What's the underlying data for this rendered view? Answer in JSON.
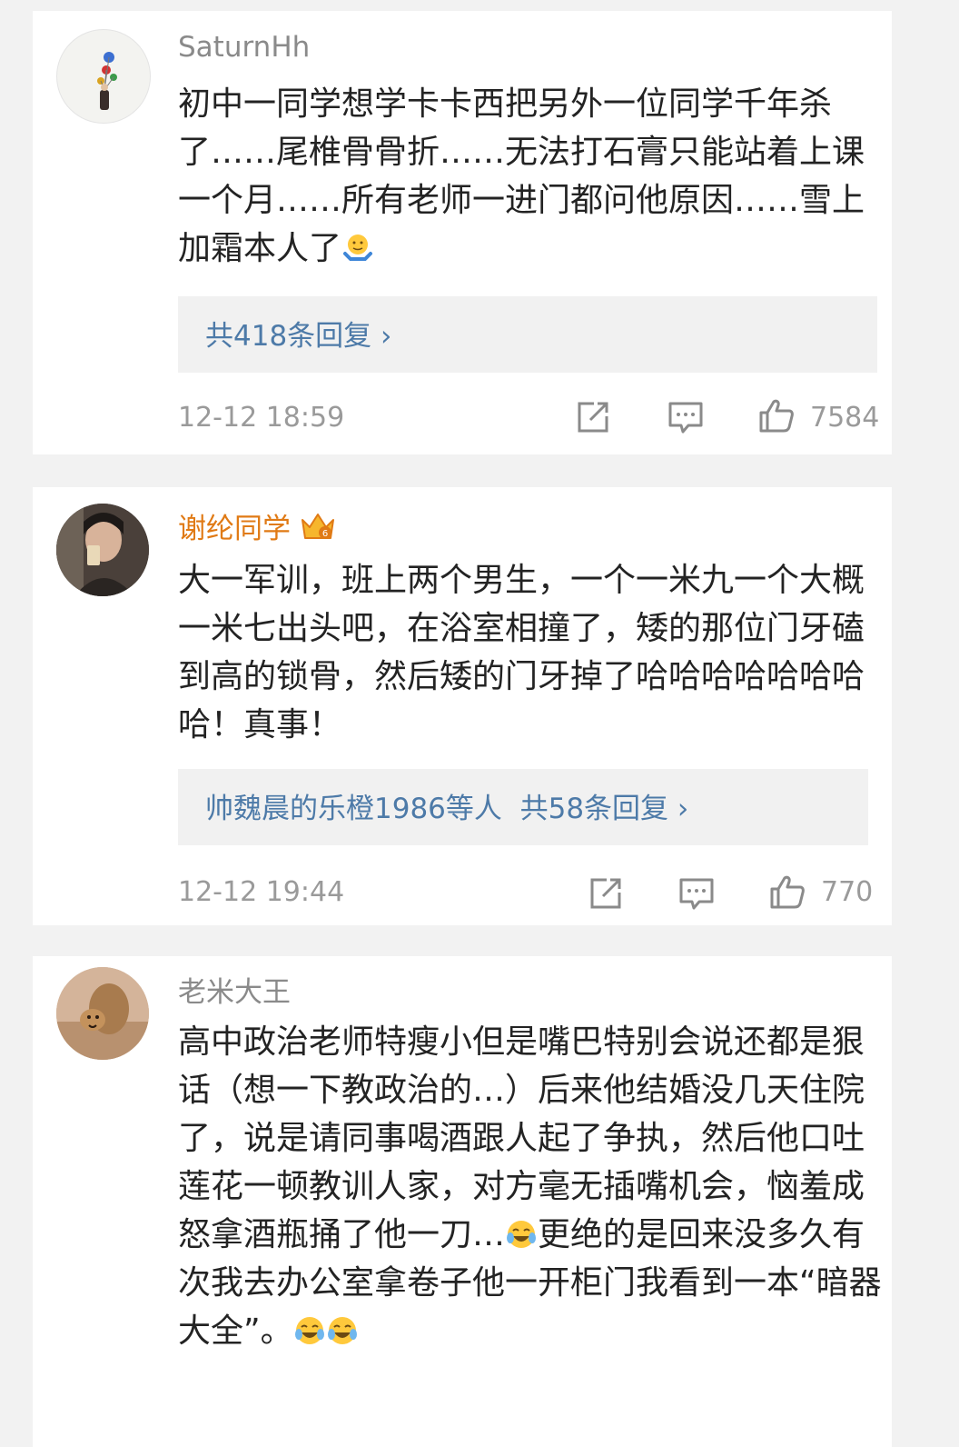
{
  "comments": [
    {
      "username": "SaturnHh",
      "text_before_emoji": "初中一同学想学卡卡西把另外一位同学千年杀了……尾椎骨骨折……无法打石膏只能站着上课一个月……所有老师一进门都问他原因……雪上加霜本人了",
      "emoji": "shrug-emoji",
      "reply_summary": "共418条回复",
      "time": "12-12 18:59",
      "likes": "7584"
    },
    {
      "username": "谢纶同学",
      "badge": "crown-badge",
      "text": "大一军训，班上两个男生，一个一米九一个大概一米七出头吧，在浴室相撞了，矮的那位门牙磕到高的锁骨，然后矮的门牙掉了哈哈哈哈哈哈哈哈！真事！",
      "reply_summary": "帅魏晨的乐橙1986等人  共58条回复",
      "time": "12-12 19:44",
      "likes": "770"
    },
    {
      "username": "老米大王",
      "text_part1": "高中政治老师特瘦小但是嘴巴特别会说还都是狠话（想一下教政治的…）后来他结婚没几天住院了，说是请同事喝酒跟人起了争执，然后他口吐莲花一顿教训人家，对方毫无插嘴机会，恼羞成怒拿酒瓶捅了他一刀…",
      "text_part2": "更绝的是回来没多久有次我去办公室拿卷子他一开柜门我看到一本“暗器大全”。",
      "emoji": "laugh-cry-emoji"
    }
  ],
  "colors": {
    "username": "#8a8a8a",
    "vip_username": "#e07a15",
    "link": "#4d7aa8",
    "meta": "#9a9a9a"
  }
}
